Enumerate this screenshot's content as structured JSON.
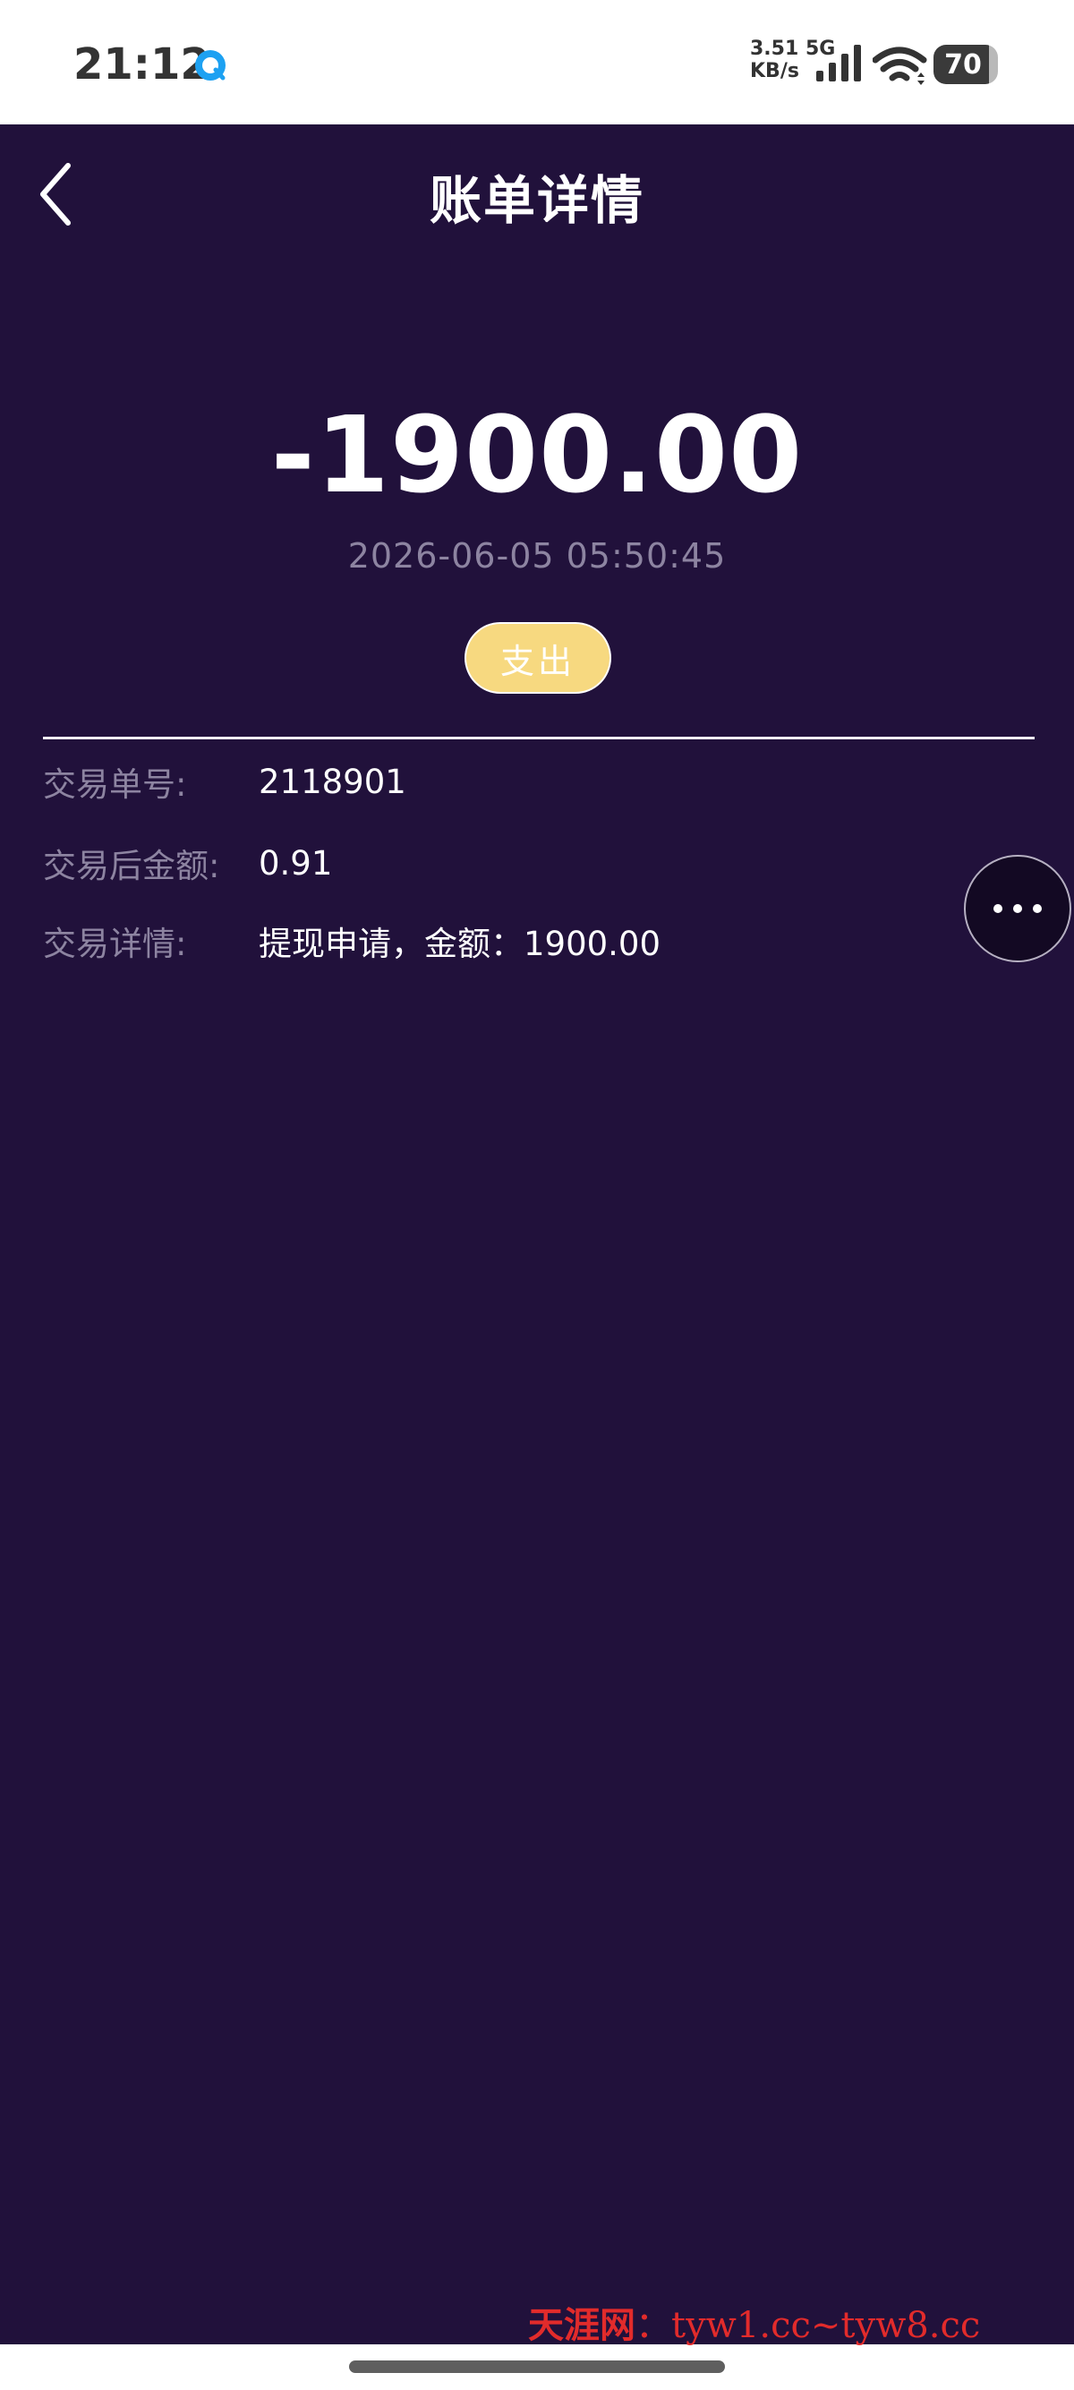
{
  "status_bar": {
    "time": "21:12",
    "app_icon": "browser-icon",
    "network_speed_value": "3.51",
    "network_type": "5G",
    "network_speed_unit": "KB/s",
    "signal_icon": "signal-bars-icon",
    "wifi_icon": "wifi-icon",
    "battery": "70"
  },
  "header": {
    "back_icon": "chevron-left-icon",
    "title": "账单详情"
  },
  "summary": {
    "amount": "-1900.00",
    "datetime": "2026-06-05 05:50:45",
    "type_label": "支出"
  },
  "details": [
    {
      "label": "交易单号:",
      "value": "2118901"
    },
    {
      "label": "交易后金额:",
      "value": "0.91"
    },
    {
      "label": "交易详情:",
      "value": "提现申请，金额：1900.00"
    }
  ],
  "floating_button": {
    "icon": "more-horizontal-icon"
  },
  "watermark": {
    "brand": "天涯网",
    "separator": "：",
    "text": "tyw1.cc~tyw8.cc"
  },
  "colors": {
    "background": "#21113b",
    "badge": "#f7d980",
    "muted_text": "#8d84a1",
    "watermark": "#e22b2b"
  }
}
